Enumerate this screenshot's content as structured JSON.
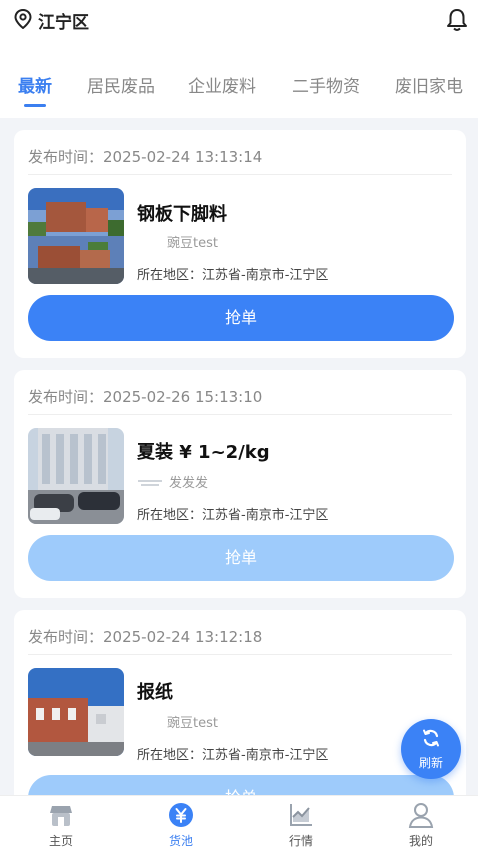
{
  "location": {
    "text": "江宁区"
  },
  "tabs": [
    {
      "label": "最新",
      "active": true
    },
    {
      "label": "居民废品",
      "active": false
    },
    {
      "label": "企业废料",
      "active": false
    },
    {
      "label": "二手物资",
      "active": false
    },
    {
      "label": "废旧家电",
      "active": false
    }
  ],
  "cards": [
    {
      "publish_time": "发布时间：2025-02-24 13:13:14",
      "title": "钢板下脚料",
      "user": "豌豆test",
      "region": "所在地区：江苏省-南京市-江宁区",
      "button_label": "抢单",
      "button_state": "active"
    },
    {
      "publish_time": "发布时间：2025-02-26 15:13:10",
      "title": "夏装 ¥ 1~2/kg",
      "user": "发发发",
      "region": "所在地区：江苏省-南京市-江宁区",
      "button_label": "抢单",
      "button_state": "disabled"
    },
    {
      "publish_time": "发布时间：2025-02-24 13:12:18",
      "title": "报纸",
      "user": "豌豆test",
      "region": "所在地区：江苏省-南京市-江宁区",
      "button_label": "抢单",
      "button_state": "disabled"
    }
  ],
  "fab": {
    "label": "刷新"
  },
  "nav": [
    {
      "label": "主页",
      "icon": "home-icon",
      "active": false
    },
    {
      "label": "货池",
      "icon": "yuan-icon",
      "active": true
    },
    {
      "label": "行情",
      "icon": "chart-icon",
      "active": false
    },
    {
      "label": "我的",
      "icon": "user-icon",
      "active": false
    }
  ],
  "colors": {
    "accent": "#3b82f6",
    "disabled_button": "#9ecbfb",
    "background": "#f2f4f8"
  }
}
